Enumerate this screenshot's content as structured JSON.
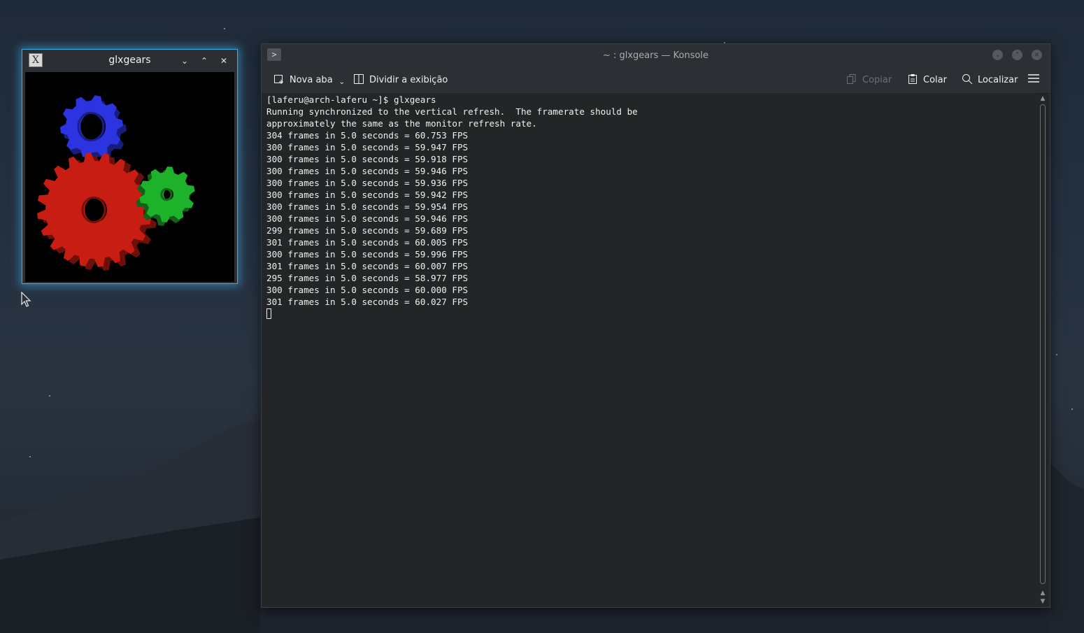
{
  "glxgears_window": {
    "title": "glxgears",
    "app_icon": "X",
    "buttons": {
      "minimize": "⌄",
      "maximize": "⌃",
      "close": "✕"
    },
    "gear_colors": {
      "red": "#c81d12",
      "green": "#1eb12a",
      "blue": "#2b34e0"
    }
  },
  "konsole_window": {
    "title": "~ : glxgears — Konsole",
    "prompt_icon": ">",
    "toolbar": {
      "new_tab_label": "Nova aba",
      "split_view_label": "Dividir a exibição",
      "copy_label": "Copiar",
      "paste_label": "Colar",
      "find_label": "Localizar"
    },
    "terminal_lines": [
      "[laferu@arch-laferu ~]$ glxgears",
      "Running synchronized to the vertical refresh.  The framerate should be",
      "approximately the same as the monitor refresh rate.",
      "304 frames in 5.0 seconds = 60.753 FPS",
      "300 frames in 5.0 seconds = 59.947 FPS",
      "300 frames in 5.0 seconds = 59.918 FPS",
      "300 frames in 5.0 seconds = 59.946 FPS",
      "300 frames in 5.0 seconds = 59.936 FPS",
      "300 frames in 5.0 seconds = 59.942 FPS",
      "300 frames in 5.0 seconds = 59.954 FPS",
      "300 frames in 5.0 seconds = 59.946 FPS",
      "299 frames in 5.0 seconds = 59.689 FPS",
      "301 frames in 5.0 seconds = 60.005 FPS",
      "300 frames in 5.0 seconds = 59.996 FPS",
      "301 frames in 5.0 seconds = 60.007 FPS",
      "295 frames in 5.0 seconds = 58.977 FPS",
      "300 frames in 5.0 seconds = 60.000 FPS",
      "301 frames in 5.0 seconds = 60.027 FPS"
    ]
  },
  "colors": {
    "accent": "#3daee9",
    "terminal_bg": "#232627",
    "terminal_fg": "#eff0f1"
  }
}
